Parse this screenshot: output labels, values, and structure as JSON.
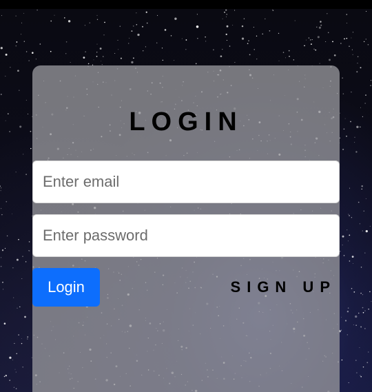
{
  "login_card": {
    "title": "LOGIN",
    "email_placeholder": "Enter email",
    "password_placeholder": "Enter password",
    "login_button_label": "Login",
    "signup_label": "SIGN UP"
  },
  "colors": {
    "login_button": "#0d6efd",
    "card_overlay": "#96969b"
  },
  "background": {
    "icon": "starry-night-sky"
  }
}
